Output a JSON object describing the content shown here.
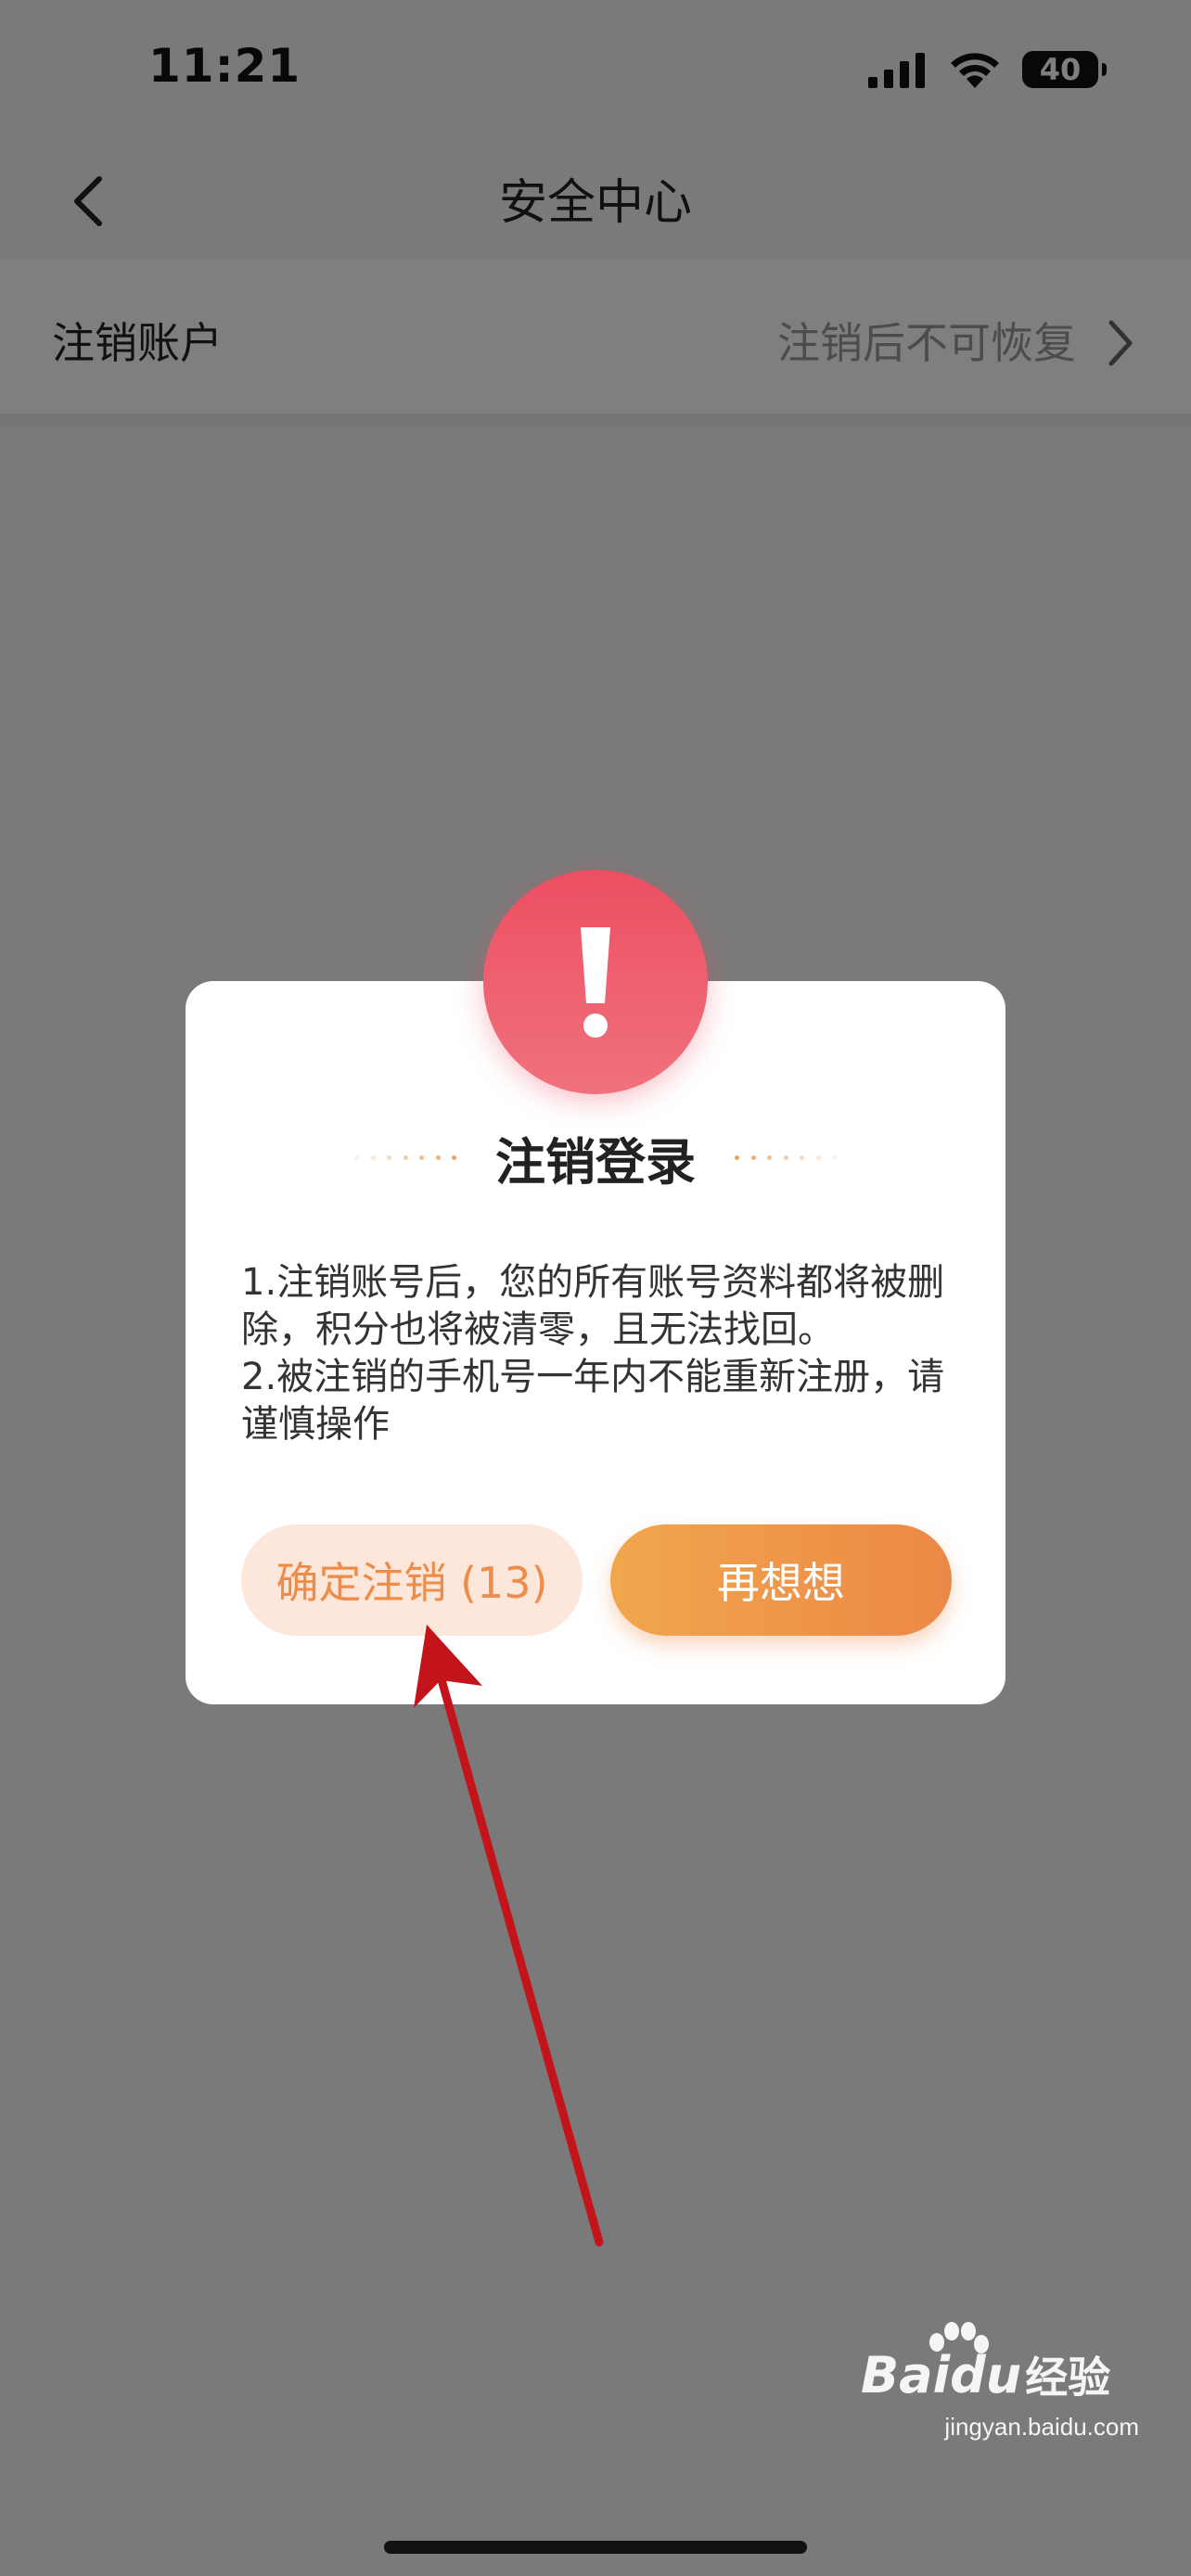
{
  "status_bar": {
    "time": "11:21",
    "battery": "40"
  },
  "nav": {
    "title": "安全中心"
  },
  "list": {
    "row_label": "注销账户",
    "row_hint": "注销后不可恢复"
  },
  "dialog": {
    "badge_symbol": "!",
    "title": "注销登录",
    "body_lines": [
      "1.注销账号后，您的所有账号资料都将被删除，积分也将被清零，且无法找回。",
      "2.被注销的手机号一年内不能重新注册，请谨慎操作"
    ],
    "confirm_label": "确定注销 (13)",
    "cancel_label": "再想想"
  },
  "watermark": {
    "brand": "Bai",
    "brand_tail": "du",
    "brand_cn": "经验",
    "url": "jingyan.baidu.com"
  },
  "colors": {
    "accent_orange": "#ec8846",
    "alert_red": "#ec4f62",
    "annotation_red": "#c4141b"
  },
  "icons": {
    "back": "chevron-left-icon",
    "row_arrow": "chevron-right-icon",
    "alert": "exclamation-icon"
  }
}
